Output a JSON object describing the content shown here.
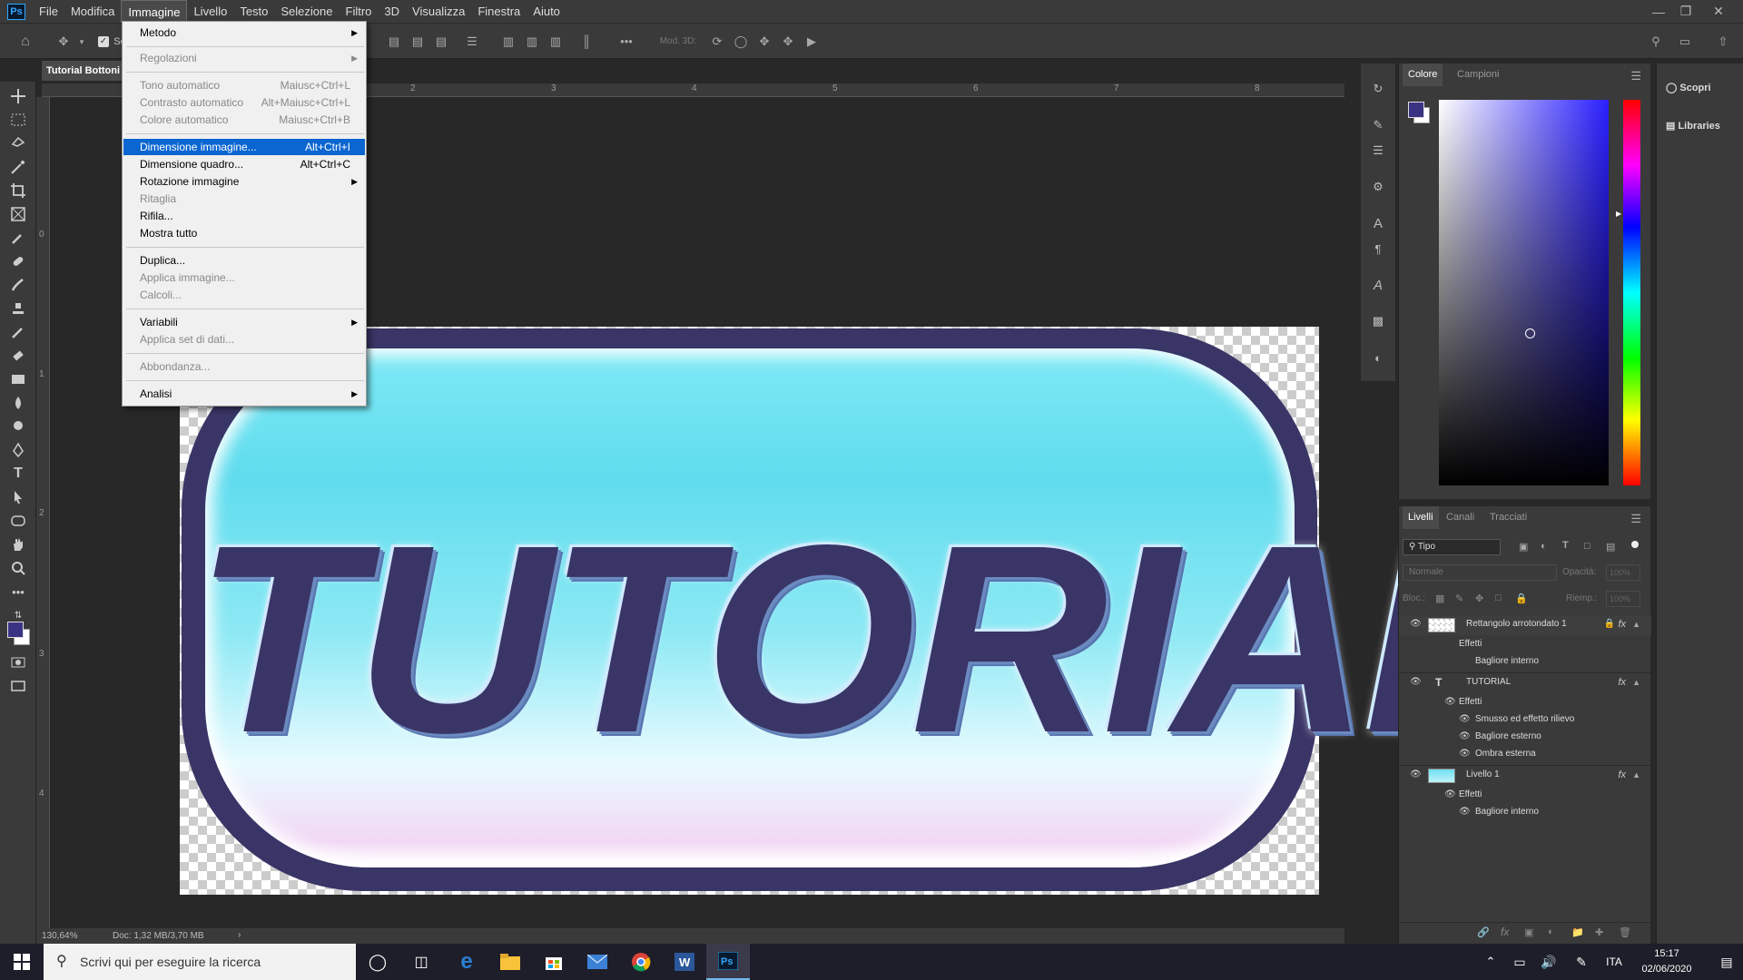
{
  "menubar": {
    "items": [
      "File",
      "Modifica",
      "Immagine",
      "Livello",
      "Testo",
      "Selezione",
      "Filtro",
      "3D",
      "Visualizza",
      "Finestra",
      "Aiuto"
    ],
    "active": "Immagine"
  },
  "optbar": {
    "mode3d": "Mod. 3D:",
    "check_label": "Se"
  },
  "doc": {
    "tab_title": "Tutorial Bottoni"
  },
  "rulers": {
    "h": [
      "2",
      "3",
      "4",
      "5",
      "6",
      "7",
      "8"
    ],
    "v": [
      "0",
      "1",
      "2",
      "3",
      "4"
    ]
  },
  "canvas": {
    "text": "TUTORIAL"
  },
  "status": {
    "zoom": "130,64%",
    "doc": "Doc: 1,32 MB/3,70 MB"
  },
  "dropdown": {
    "items": [
      {
        "label": "Metodo",
        "shortcut": "",
        "sub": true,
        "disabled": false
      },
      {
        "label": "Regolazioni",
        "shortcut": "",
        "sub": true,
        "disabled": true
      },
      {
        "label": "Tono automatico",
        "shortcut": "Maiusc+Ctrl+L",
        "sub": false,
        "disabled": true
      },
      {
        "label": "Contrasto automatico",
        "shortcut": "Alt+Maiusc+Ctrl+L",
        "sub": false,
        "disabled": true
      },
      {
        "label": "Colore automatico",
        "shortcut": "Maiusc+Ctrl+B",
        "sub": false,
        "disabled": true
      },
      {
        "label": "Dimensione immagine...",
        "shortcut": "Alt+Ctrl+I",
        "sub": false,
        "disabled": false,
        "highlighted": true
      },
      {
        "label": "Dimensione quadro...",
        "shortcut": "Alt+Ctrl+C",
        "sub": false,
        "disabled": false
      },
      {
        "label": "Rotazione immagine",
        "shortcut": "",
        "sub": true,
        "disabled": false
      },
      {
        "label": "Ritaglia",
        "shortcut": "",
        "sub": false,
        "disabled": true
      },
      {
        "label": "Rifila...",
        "shortcut": "",
        "sub": false,
        "disabled": false
      },
      {
        "label": "Mostra tutto",
        "shortcut": "",
        "sub": false,
        "disabled": false
      },
      {
        "label": "Duplica...",
        "shortcut": "",
        "sub": false,
        "disabled": false
      },
      {
        "label": "Applica immagine...",
        "shortcut": "",
        "sub": false,
        "disabled": true
      },
      {
        "label": "Calcoli...",
        "shortcut": "",
        "sub": false,
        "disabled": true
      },
      {
        "label": "Variabili",
        "shortcut": "",
        "sub": true,
        "disabled": false
      },
      {
        "label": "Applica set di dati...",
        "shortcut": "",
        "sub": false,
        "disabled": true
      },
      {
        "label": "Abbondanza...",
        "shortcut": "",
        "sub": false,
        "disabled": true
      },
      {
        "label": "Analisi",
        "shortcut": "",
        "sub": true,
        "disabled": false
      }
    ]
  },
  "color_panel": {
    "tabs": [
      "Colore",
      "Campioni"
    ],
    "fg_color": "#3a3384"
  },
  "right_panel": {
    "scopri": "Scopri",
    "libraries": "Libraries"
  },
  "layers": {
    "tabs": [
      "Livelli",
      "Canali",
      "Tracciati"
    ],
    "filter": "Tipo",
    "blend": "Normale",
    "opacity_label": "Opacità:",
    "opacity": "100%",
    "lock_label": "Bloc.:",
    "fill_label": "Riemp.:",
    "fill": "100%",
    "rows": [
      {
        "name": "Rettangolo arrotondato 1",
        "effects_label": "Effetti",
        "effects": [
          "Bagliore interno"
        ]
      },
      {
        "name": "TUTORIAL",
        "effects_label": "Effetti",
        "effects": [
          "Smusso ed effetto rilievo",
          "Bagliore esterno",
          "Ombra esterna"
        ]
      },
      {
        "name": "Livello 1",
        "effects_label": "Effetti",
        "effects": [
          "Bagliore interno"
        ]
      }
    ]
  },
  "taskbar": {
    "search": "Scrivi qui per eseguire la ricerca",
    "lang": "ITA",
    "time": "15:17",
    "date": "02/06/2020"
  }
}
